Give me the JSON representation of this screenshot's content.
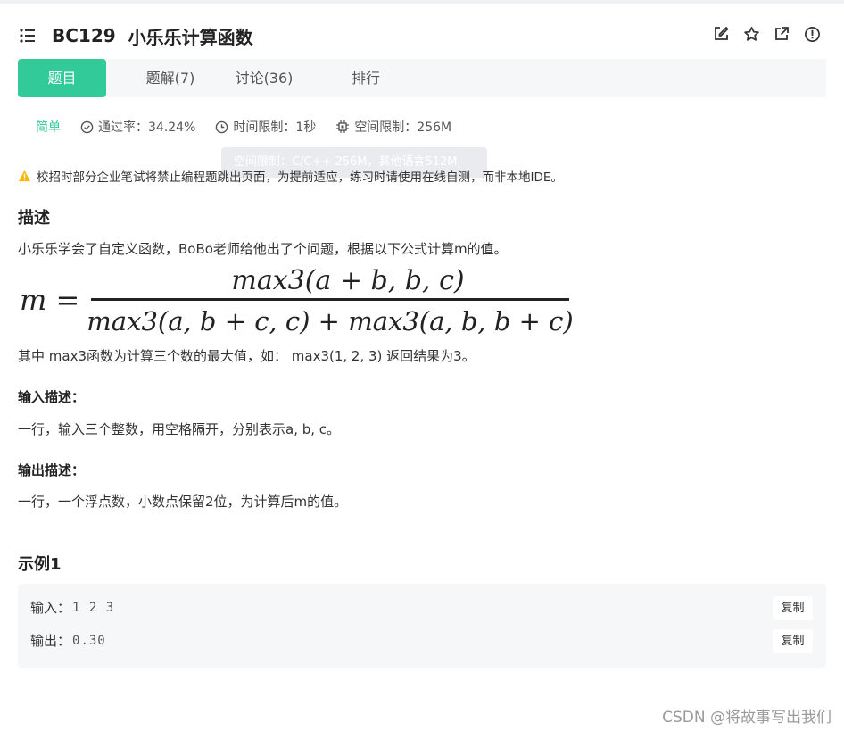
{
  "header": {
    "code": "BC129",
    "name": "小乐乐计算函数",
    "icons": [
      "menu-icon",
      "edit-icon",
      "star-icon",
      "external-link-icon",
      "alert-circle-icon"
    ]
  },
  "tabs": [
    {
      "label": "题目",
      "active": true
    },
    {
      "label": "题解(7)",
      "active": false
    },
    {
      "label": "讨论(36)",
      "active": false
    },
    {
      "label": "排行",
      "active": false
    }
  ],
  "meta": {
    "difficulty": "简单",
    "pass_rate": "通过率：34.24%",
    "time_limit": "时间限制：1秒",
    "space_limit": "空间限制：256M"
  },
  "tooltip": "空间限制：C/C++ 256M，其他语言512M",
  "warning": "校招时部分企业笔试将禁止编程题跳出页面，为提前适应，练习时请使用在线自测，而非本地IDE。",
  "description": {
    "heading": "描述",
    "intro": "小乐乐学会了自定义函数，BoBo老师给他出了个问题，根据以下公式计算m的值。",
    "formula": {
      "lhs": "m =",
      "numerator": "max3(a + b, b, c)",
      "denominator": "max3(a, b + c, c) + max3(a, b, b + c)"
    },
    "note": "其中 max3函数为计算三个数的最大值，如： max3(1, 2, 3) 返回结果为3。"
  },
  "input": {
    "heading": "输入描述：",
    "text": "一行，输入三个整数，用空格隔开，分别表示a, b, c。"
  },
  "output": {
    "heading": "输出描述：",
    "text": "一行，一个浮点数，小数点保留2位，为计算后m的值。"
  },
  "example": {
    "heading": "示例1",
    "input_label": "输入：",
    "input_value": "1 2 3",
    "output_label": "输出：",
    "output_value": "0.30",
    "copy_label": "复制"
  },
  "watermark": "CSDN @将故事写出我们",
  "colors": {
    "accent": "#32ca99",
    "warning": "#f5b800"
  }
}
